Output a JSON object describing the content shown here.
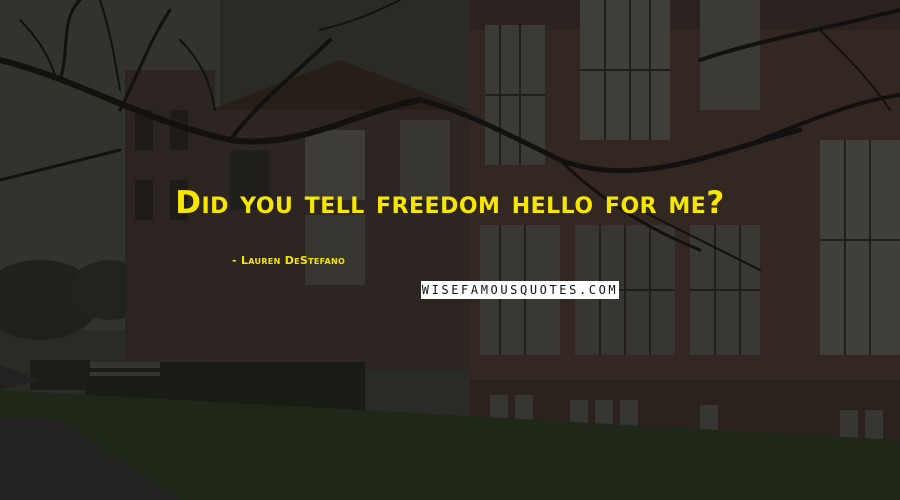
{
  "quote": {
    "text": "Did you tell freedom hello for me?",
    "author": "- Lauren DeStefano"
  },
  "watermark": {
    "text": "WISEFAMOUSQUOTES.COM"
  },
  "colors": {
    "quote_text": "#f7e600",
    "background_dark": "#2a2926",
    "brick": "#4a3530",
    "grass": "#27331c",
    "watermark_bg": "#ffffff"
  }
}
